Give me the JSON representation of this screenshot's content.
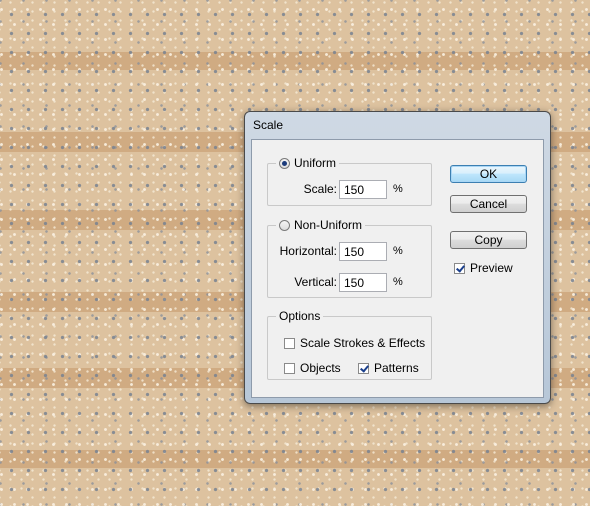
{
  "dialog": {
    "title": "Scale",
    "uniform": {
      "label": "Uniform",
      "selected": true,
      "scale_label": "Scale:",
      "scale_value": "150",
      "unit": "%"
    },
    "non_uniform": {
      "label": "Non-Uniform",
      "selected": false,
      "horizontal_label": "Horizontal:",
      "horizontal_value": "150",
      "vertical_label": "Vertical:",
      "vertical_value": "150",
      "unit": "%"
    },
    "options": {
      "label": "Options",
      "scale_strokes_label": "Scale Strokes & Effects",
      "scale_strokes_checked": false,
      "objects_label": "Objects",
      "objects_checked": false,
      "patterns_label": "Patterns",
      "patterns_checked": true
    },
    "buttons": {
      "ok": "OK",
      "cancel": "Cancel",
      "copy": "Copy"
    },
    "preview": {
      "label": "Preview",
      "checked": true
    }
  },
  "colors": {
    "sand_light": "#ddc29f",
    "sand_dark": "#d0ab82",
    "dialog_frame": "#b7c7d8",
    "dialog_body": "#f0f0f0"
  }
}
